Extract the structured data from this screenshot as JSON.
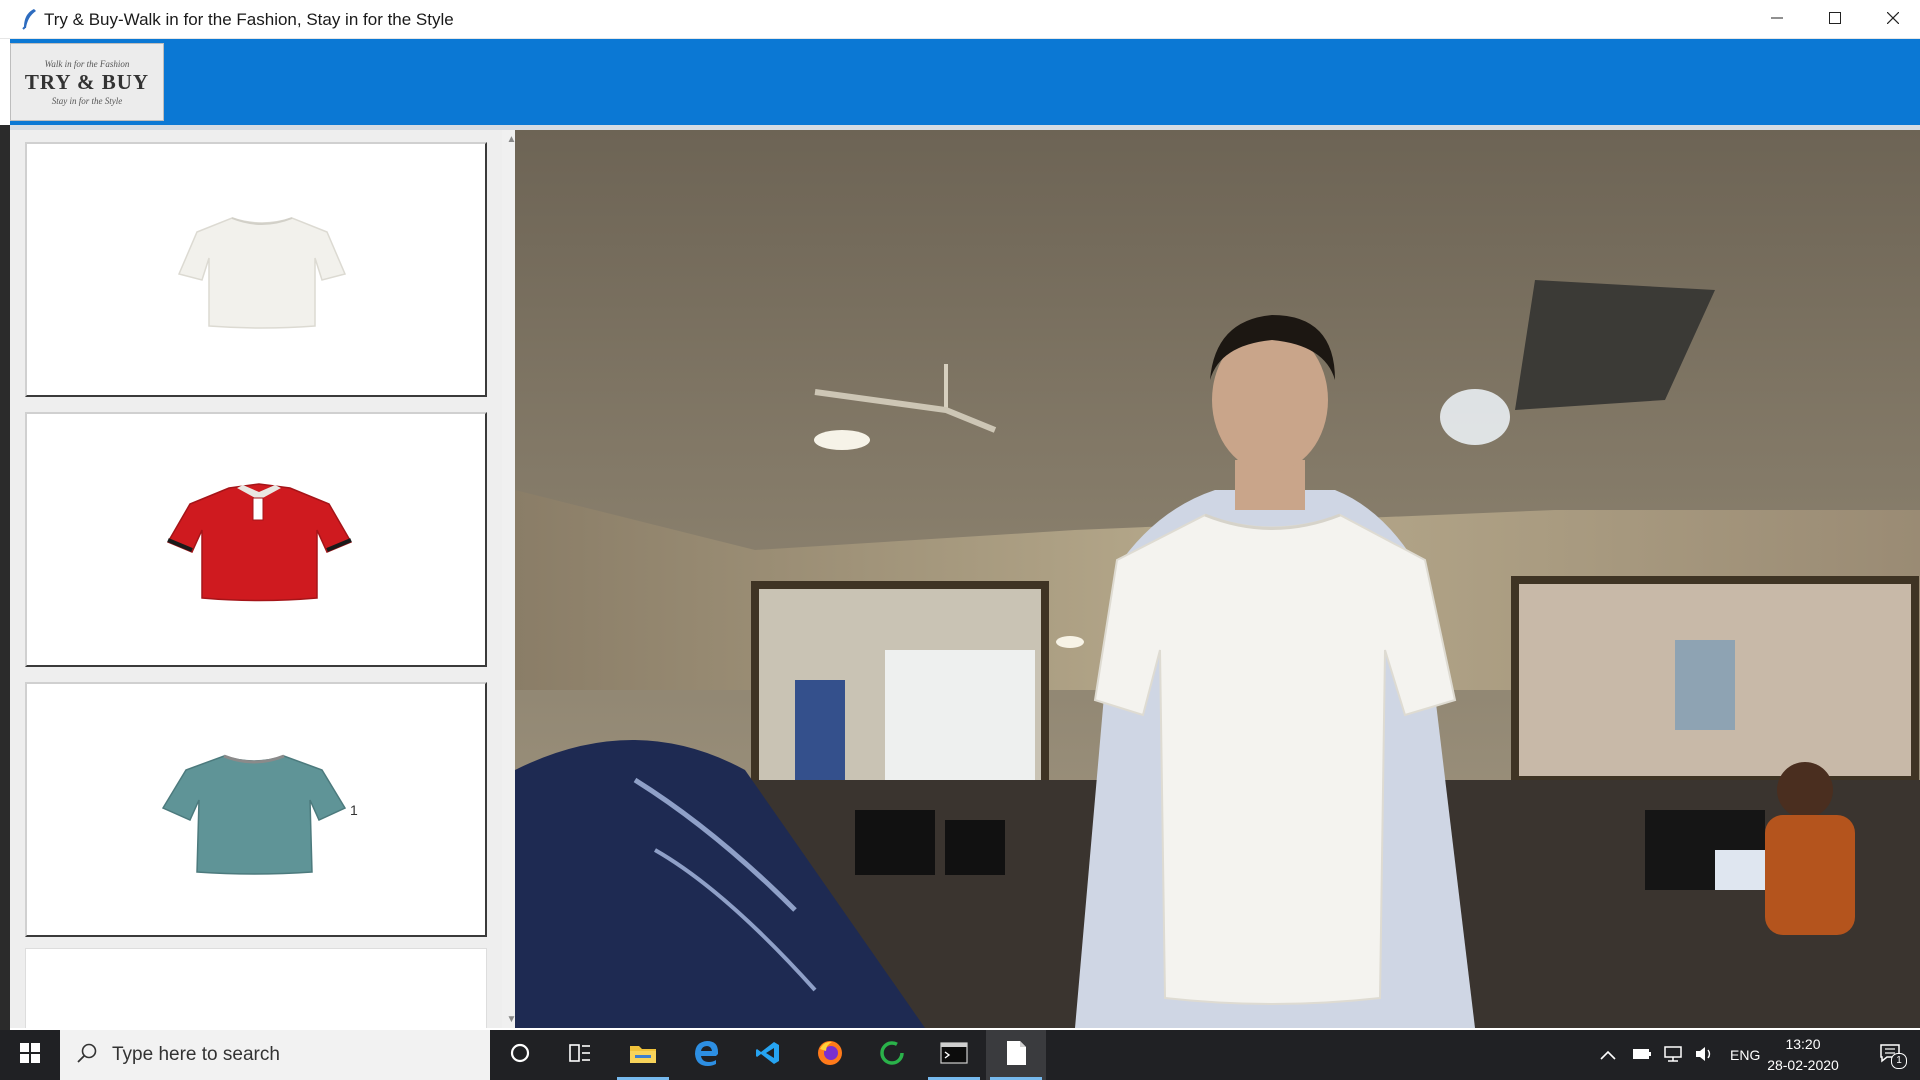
{
  "window": {
    "title": "Try & Buy-Walk in for the Fashion, Stay in for the Style",
    "controls": [
      "minimize-icon",
      "maximize-icon",
      "close-icon"
    ]
  },
  "header": {
    "accent_color": "#0b78d4",
    "logo": {
      "tagline_top": "Walk in for the Fashion",
      "brand": "TRY & BUY",
      "tagline_bottom": "Stay in for the Style"
    }
  },
  "catalog": {
    "items": [
      {
        "name": "white-tshirt",
        "color": "#f2f1ec"
      },
      {
        "name": "red-polo-shirt",
        "color": "#cf1a1f"
      },
      {
        "name": "teal-tshirt",
        "color": "#5f9497",
        "label": "1"
      }
    ]
  },
  "camera": {
    "overlay_shirt_color": "#f4f3ef"
  },
  "taskbar": {
    "search_placeholder": "Type here to search",
    "apps": [
      "cortana-icon",
      "task-view-icon",
      "file-explorer-icon",
      "edge-icon",
      "vscode-icon",
      "firefox-icon",
      "refresh-app-icon",
      "terminal-icon",
      "notepad-icon"
    ],
    "language": "ENG",
    "time": "13:20",
    "date": "28-02-2020",
    "notification_count": "1"
  }
}
